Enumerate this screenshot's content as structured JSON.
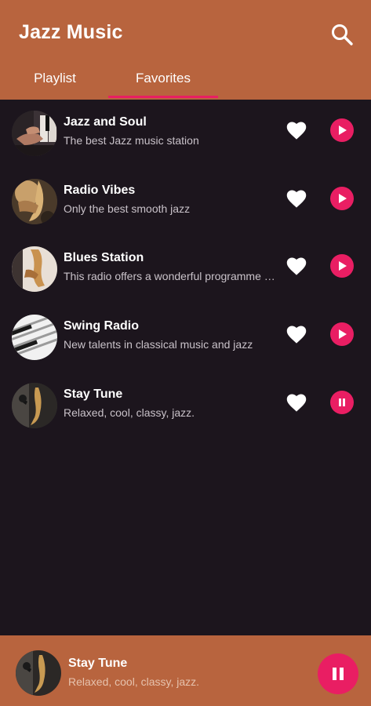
{
  "app": {
    "title": "Jazz Music",
    "accent": "#b8643e",
    "pink": "#e91e63",
    "background": "#1c151d"
  },
  "header": {
    "search_icon": "search-icon"
  },
  "tabs": [
    {
      "label": "Playlist",
      "active": false
    },
    {
      "label": "Favorites",
      "active": true
    }
  ],
  "stations": [
    {
      "name": "Jazz and Soul",
      "description": "The best Jazz music station",
      "favorite": true,
      "state": "play",
      "image": "piano-hands"
    },
    {
      "name": "Radio Vibes",
      "description": "Only the best smooth jazz",
      "favorite": true,
      "state": "play",
      "image": "saxophone-gold"
    },
    {
      "name": "Blues Station",
      "description": "This radio offers a wonderful programme of blues music",
      "favorite": true,
      "state": "play",
      "image": "saxophone-player"
    },
    {
      "name": "Swing Radio",
      "description": "New talents in classical music and jazz",
      "favorite": true,
      "state": "play",
      "image": "piano-keys"
    },
    {
      "name": "Stay Tune",
      "description": "Relaxed, cool, classy, jazz.",
      "favorite": true,
      "state": "pause",
      "image": "saxophone-mic"
    }
  ],
  "player": {
    "name": "Stay Tune",
    "description": "Relaxed, cool, classy, jazz.",
    "state": "pause",
    "image": "saxophone-mic"
  }
}
